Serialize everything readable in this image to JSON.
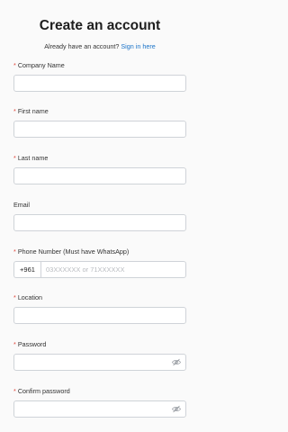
{
  "header": {
    "title": "Create an account",
    "subtitle_prefix": "Already have an account?",
    "signin_link": "Sign in here"
  },
  "colors": {
    "accent": "#1a73c8",
    "required": "#e0453a",
    "border": "#cfd3d8"
  },
  "fields": {
    "company": {
      "required": "*",
      "label": "Company Name",
      "value": ""
    },
    "first_name": {
      "required": "*",
      "label": "First name",
      "value": ""
    },
    "last_name": {
      "required": "*",
      "label": "Last name",
      "value": ""
    },
    "email": {
      "label": "Email",
      "value": ""
    },
    "phone": {
      "required": "*",
      "label": "Phone Number (Must have WhatsApp)",
      "prefix": "+961",
      "placeholder": "03XXXXXX or 71XXXXXX",
      "value": ""
    },
    "location": {
      "required": "*",
      "label": "Location",
      "value": ""
    },
    "password": {
      "required": "*",
      "label": "Password",
      "value": "",
      "icon": "eye-off-icon"
    },
    "confirm_password": {
      "required": "*",
      "label": "Confirm password",
      "value": "",
      "icon": "eye-off-icon"
    }
  }
}
